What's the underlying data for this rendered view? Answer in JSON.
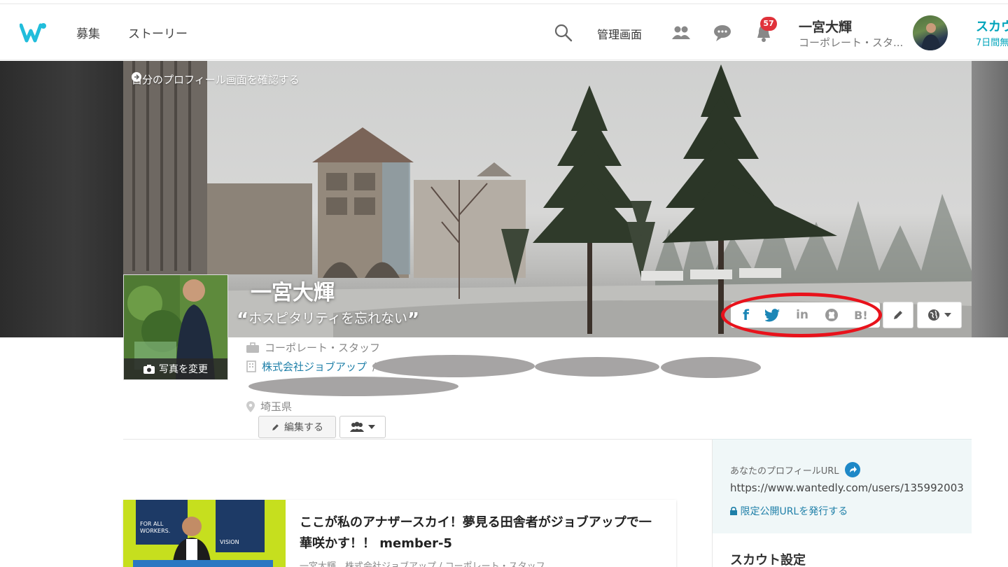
{
  "header": {
    "logo": "wantedly-logo",
    "nav": [
      {
        "label": "募集"
      },
      {
        "label": "ストーリー"
      }
    ],
    "admin_label": "管理画面",
    "notifications_count": "57",
    "user_name": "一宮大輝",
    "user_title": "コーポレート・スタ...",
    "scout_label": "スカウ",
    "scout_sub": "7日間無"
  },
  "cover": {
    "view_profile_link": "自分のプロフィール画面を確認する",
    "name": "一宮大輝",
    "catchphrase": "ホスピタリティを忘れない",
    "quote_open": "“",
    "quote_close": "”",
    "social_icons": [
      "facebook-icon",
      "twitter-icon",
      "linkedin-icon",
      "github-icon",
      "hatena-bookmark-icon"
    ],
    "social_labels": {
      "facebook": "f",
      "linkedin": "in",
      "hatena": "B!"
    }
  },
  "photo": {
    "change_label": "写真を変更"
  },
  "profile": {
    "role": "コーポレート・スタッフ",
    "company": "株式会社ジョブアップ",
    "company_sep": "/",
    "location": "埼玉県",
    "edit_button": "編集する"
  },
  "sidebar": {
    "profile_url_label": "あなたのプロフィールURL",
    "profile_url": "https://www.wantedly.com/users/135992003",
    "limited_url_label": "限定公開URLを発行する",
    "scout_settings": "スカウト設定"
  },
  "story": {
    "title": "ここが私のアナザースカイ！夢見る田舎者がジョブアップで一華咲かす！！ member-5",
    "meta": "一宮大輝　株式会社ジョブアップ / コーポレート・スタッフ",
    "thumb_text_1": "FOR ALL WORKERS.",
    "thumb_text_2": "VISION"
  },
  "colors": {
    "accent": "#00a4bb",
    "badge": "#e0323a",
    "highlight_oval": "#e8121b",
    "link": "#1e7fa8"
  }
}
